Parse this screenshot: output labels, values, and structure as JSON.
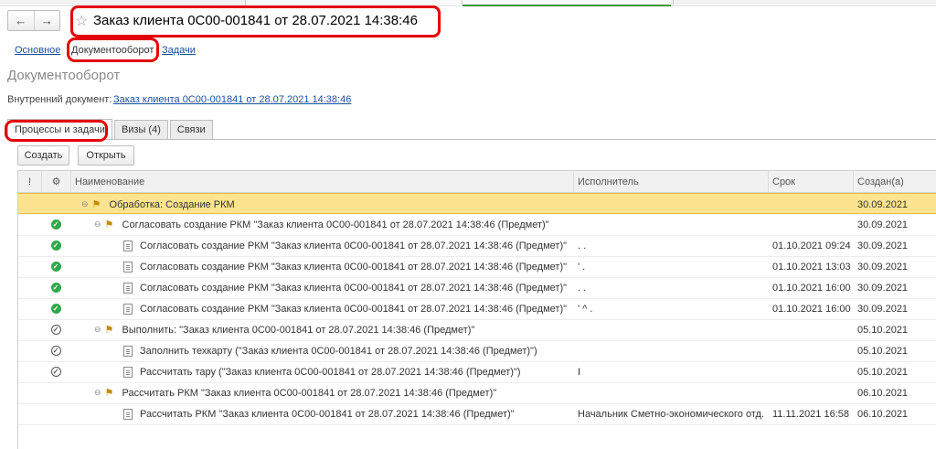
{
  "window": {
    "title": "Заказ клиента 0С00-001841 от 28.07.2021 14:38:46"
  },
  "nav": {
    "back": "←",
    "forward": "→",
    "star": "☆"
  },
  "links": {
    "main": "Основное",
    "docflow": "Документооборот",
    "tasks": "Задачи"
  },
  "section_title": "Документооборот",
  "internal_doc": {
    "label": "Внутренний документ:",
    "value": "Заказ клиента 0С00-001841 от 28.07.2021 14:38:46"
  },
  "tabs": [
    "Процессы и задачи",
    "Визы (4)",
    "Связи"
  ],
  "toolbar": {
    "create": "Создать",
    "open": "Открыть"
  },
  "columns": {
    "importance": "!",
    "name": "Наименование",
    "executor": "Исполнитель",
    "due": "Срок",
    "created": "Создан(а)"
  },
  "rows": [
    {
      "status": "",
      "level": 0,
      "kind": "process",
      "name": "Обработка: Создание РКМ",
      "executor": "",
      "due": "",
      "created": "30.09.2021",
      "selected": true
    },
    {
      "status": "done",
      "level": 1,
      "kind": "process",
      "name": "Согласовать создание РКМ \"Заказ клиента 0С00-001841 от 28.07.2021 14:38:46 (Предмет)\"",
      "executor": "",
      "due": "",
      "created": "30.09.2021"
    },
    {
      "status": "done",
      "level": 2,
      "kind": "task",
      "name": "Согласовать создание РКМ \"Заказ клиента 0С00-001841 от 28.07.2021 14:38:46 (Предмет)\"",
      "executor": ". .",
      "due": "01.10.2021 09:24",
      "created": "30.09.2021"
    },
    {
      "status": "done",
      "level": 2,
      "kind": "task",
      "name": "Согласовать создание РКМ \"Заказ клиента 0С00-001841 от 28.07.2021 14:38:46 (Предмет)\"",
      "executor": "' .",
      "due": "01.10.2021 13:03",
      "created": "30.09.2021"
    },
    {
      "status": "done",
      "level": 2,
      "kind": "task",
      "name": "Согласовать создание РКМ \"Заказ клиента 0С00-001841 от 28.07.2021 14:38:46 (Предмет)\"",
      "executor": ". .",
      "due": "01.10.2021 16:00",
      "created": "30.09.2021"
    },
    {
      "status": "done",
      "level": 2,
      "kind": "task",
      "name": "Согласовать создание РКМ \"Заказ клиента 0С00-001841 от 28.07.2021 14:38:46 (Предмет)\"",
      "executor": "' ^ .",
      "due": "01.10.2021 16:00",
      "created": "30.09.2021"
    },
    {
      "status": "pending",
      "level": 1,
      "kind": "process",
      "name": "Выполнить: \"Заказ клиента 0С00-001841 от 28.07.2021 14:38:46 (Предмет)\"",
      "executor": "",
      "due": "",
      "created": "05.10.2021"
    },
    {
      "status": "pending",
      "level": 2,
      "kind": "task",
      "name": "Заполнить техкарту (\"Заказ клиента 0С00-001841 от 28.07.2021 14:38:46 (Предмет)\")",
      "executor": "",
      "due": "",
      "created": "05.10.2021"
    },
    {
      "status": "pending",
      "level": 2,
      "kind": "task",
      "name": "Рассчитать тару (\"Заказ клиента 0С00-001841 от 28.07.2021 14:38:46 (Предмет)\")",
      "executor": "I",
      "due": "",
      "created": "05.10.2021"
    },
    {
      "status": "",
      "level": 1,
      "kind": "process",
      "name": "Рассчитать РКМ \"Заказ клиента 0С00-001841 от 28.07.2021 14:38:46 (Предмет)\"",
      "executor": "",
      "due": "",
      "created": "06.10.2021"
    },
    {
      "status": "",
      "level": 2,
      "kind": "task",
      "name": "Рассчитать РКМ \"Заказ клиента 0С00-001841 от 28.07.2021 14:38:46 (Предмет)\"",
      "executor": "Начальник Сметно-экономического отд...",
      "due": "11.11.2021 16:58",
      "created": "06.10.2021"
    }
  ],
  "colors": {
    "selected_row": "#fbe38f",
    "done": "#2fa94a",
    "link": "#1a4f9c",
    "annotation": "#e30000"
  }
}
